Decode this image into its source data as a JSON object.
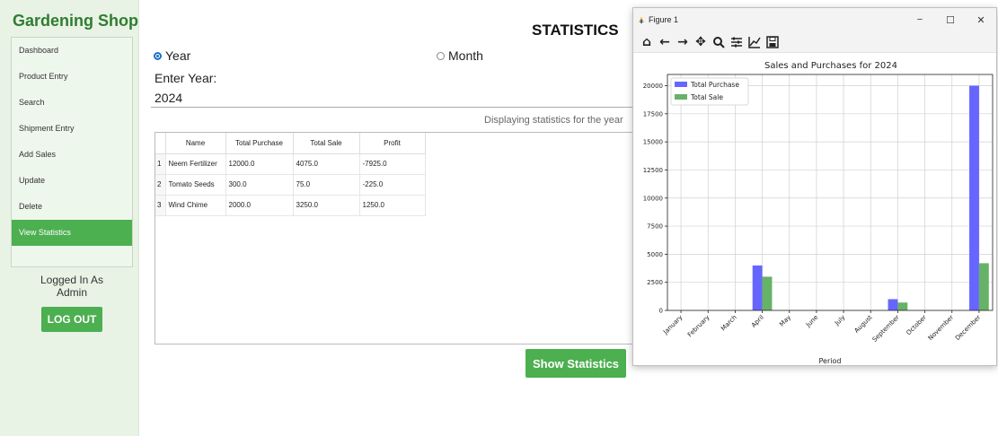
{
  "app": {
    "brand": "Gardening Shop",
    "title": "STATISTICS"
  },
  "sidebar": {
    "items": [
      {
        "label": "Dashboard"
      },
      {
        "label": "Product Entry"
      },
      {
        "label": "Search"
      },
      {
        "label": "Shipment Entry"
      },
      {
        "label": "Add Sales"
      },
      {
        "label": "Update"
      },
      {
        "label": "Delete"
      },
      {
        "label": "View Statistics"
      }
    ],
    "logged_in_line1": "Logged In As",
    "logged_in_line2": "Admin",
    "logout_label": "LOG OUT"
  },
  "filters": {
    "year_label": "Year",
    "month_label": "Month",
    "selected": "Year",
    "enter_year_label": "Enter Year:",
    "year_value": "2024"
  },
  "status_text": "Displaying statistics for the year",
  "table": {
    "headers": [
      "Name",
      "Total Purchase",
      "Total Sale",
      "Profit"
    ],
    "rows": [
      {
        "num": "1",
        "name": "Neem Fertilizer",
        "purchase": "12000.0",
        "sale": "4075.0",
        "profit": "-7925.0"
      },
      {
        "num": "2",
        "name": "Tomato Seeds",
        "purchase": "300.0",
        "sale": "75.0",
        "profit": "-225.0"
      },
      {
        "num": "3",
        "name": "Wind Chime",
        "purchase": "2000.0",
        "sale": "3250.0",
        "profit": "1250.0"
      }
    ]
  },
  "show_button_label": "Show Statistics",
  "figure_window": {
    "title": "Figure 1",
    "controls": {
      "minimize": "−",
      "maximize": "☐",
      "close": "✕"
    },
    "toolbar_icons": [
      "home-icon",
      "back-arrow-icon",
      "forward-arrow-icon",
      "pan-icon",
      "zoom-icon",
      "configure-subplots-icon",
      "edit-axis-icon",
      "save-icon"
    ]
  },
  "chart_data": {
    "type": "bar",
    "title": "Sales and Purchases for 2024",
    "xlabel": "Period",
    "ylabel": "",
    "categories": [
      "January",
      "February",
      "March",
      "April",
      "May",
      "June",
      "July",
      "August",
      "September",
      "October",
      "November",
      "December"
    ],
    "series": [
      {
        "name": "Total Purchase",
        "color": "#6666ff",
        "values": [
          0,
          0,
          0,
          4000,
          0,
          0,
          0,
          0,
          1000,
          0,
          0,
          20000
        ]
      },
      {
        "name": "Total Sale",
        "color": "#66b266",
        "values": [
          0,
          0,
          0,
          3000,
          0,
          0,
          0,
          0,
          700,
          0,
          0,
          4200
        ]
      }
    ],
    "ylim": [
      0,
      21000
    ],
    "yticks": [
      0,
      2500,
      5000,
      7500,
      10000,
      12500,
      15000,
      17500,
      20000
    ],
    "grid": true,
    "legend": "top-left"
  },
  "colors": {
    "accent": "#4caf50",
    "brand": "#2f7d2f"
  }
}
